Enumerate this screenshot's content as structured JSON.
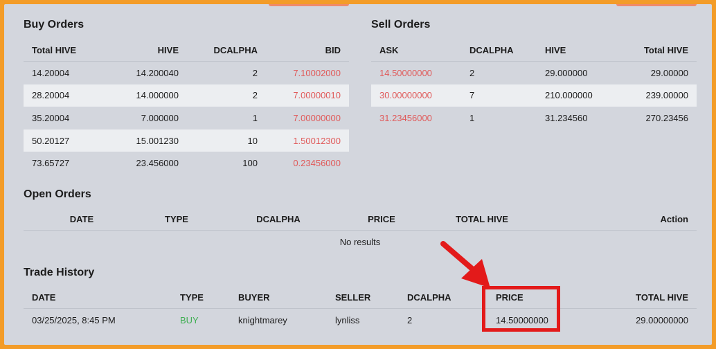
{
  "buy_orders": {
    "title": "Buy Orders",
    "headers": [
      "Total HIVE",
      "HIVE",
      "DCALPHA",
      "BID"
    ],
    "rows": [
      [
        "14.20004",
        "14.200040",
        "2",
        "7.10002000"
      ],
      [
        "28.20004",
        "14.000000",
        "2",
        "7.00000010"
      ],
      [
        "35.20004",
        "7.000000",
        "1",
        "7.00000000"
      ],
      [
        "50.20127",
        "15.001230",
        "10",
        "1.50012300"
      ],
      [
        "73.65727",
        "23.456000",
        "100",
        "0.23456000"
      ]
    ]
  },
  "sell_orders": {
    "title": "Sell Orders",
    "headers": [
      "ASK",
      "DCALPHA",
      "HIVE",
      "Total HIVE"
    ],
    "rows": [
      [
        "14.50000000",
        "2",
        "29.000000",
        "29.00000"
      ],
      [
        "30.00000000",
        "7",
        "210.000000",
        "239.00000"
      ],
      [
        "31.23456000",
        "1",
        "31.234560",
        "270.23456"
      ]
    ]
  },
  "open_orders": {
    "title": "Open Orders",
    "headers": [
      "DATE",
      "TYPE",
      "DCALPHA",
      "PRICE",
      "TOTAL HIVE",
      "Action"
    ],
    "empty_text": "No results"
  },
  "trade_history": {
    "title": "Trade History",
    "headers": [
      "DATE",
      "TYPE",
      "BUYER",
      "SELLER",
      "DCALPHA",
      "PRICE",
      "TOTAL HIVE"
    ],
    "rows": [
      [
        "03/25/2025, 8:45 PM",
        "BUY",
        "knightmarey",
        "lynliss",
        "2",
        "14.50000000",
        "29.00000000"
      ]
    ]
  },
  "colors": {
    "frame": "#f39c28",
    "panel": "#d3d6dd",
    "price_red": "#e05a5a",
    "buy_green": "#3fae52",
    "annotation_red": "#e31a1a"
  }
}
